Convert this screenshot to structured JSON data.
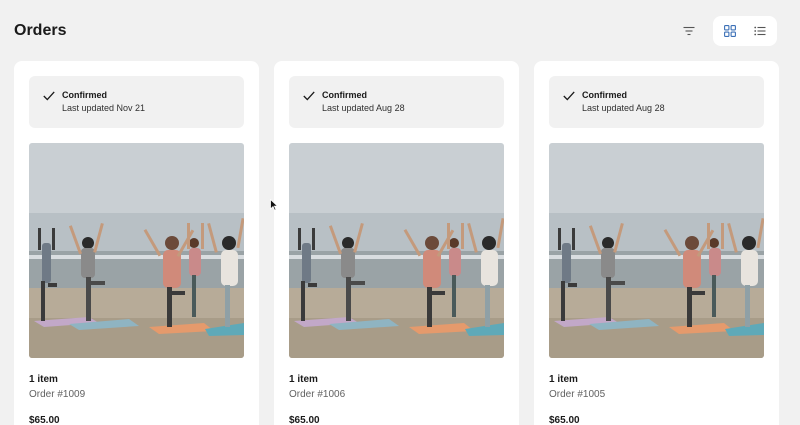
{
  "header": {
    "title": "Orders",
    "filter_icon": "filter-icon",
    "grid_view_icon": "grid-view-icon",
    "list_view_icon": "list-view-icon"
  },
  "colors": {
    "background": "#f1f1f1",
    "card": "#ffffff",
    "status_box": "#f1f1f1",
    "active_toggle_icon": "#3b6fb6"
  },
  "orders": [
    {
      "status": "Confirmed",
      "updated": "Last updated Nov 21",
      "items": "1 item",
      "order_number": "Order #1009",
      "price": "$65.00",
      "image_icon": "yoga-beach-photo"
    },
    {
      "status": "Confirmed",
      "updated": "Last updated Aug 28",
      "items": "1 item",
      "order_number": "Order #1006",
      "price": "$65.00",
      "image_icon": "yoga-beach-photo"
    },
    {
      "status": "Confirmed",
      "updated": "Last updated Aug 28",
      "items": "1 item",
      "order_number": "Order #1005",
      "price": "$65.00",
      "image_icon": "yoga-beach-photo"
    }
  ]
}
